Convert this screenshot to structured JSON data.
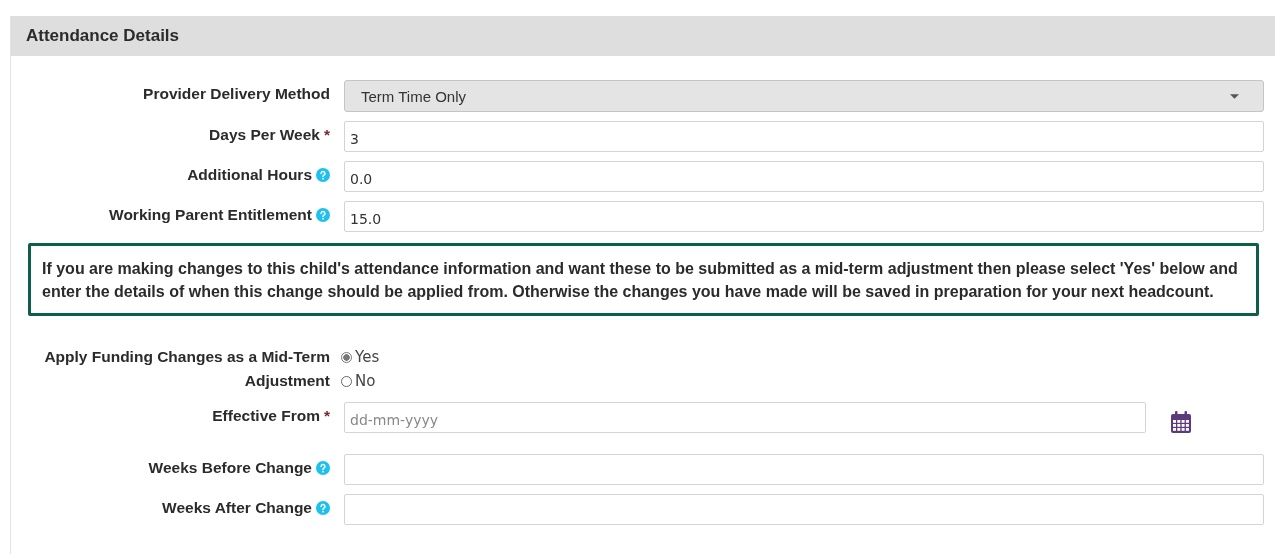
{
  "section": {
    "title": "Attendance Details"
  },
  "fields": [
    {
      "kind": "select",
      "label": "Provider Delivery Method",
      "value": "Term Time Only",
      "help": false
    },
    {
      "kind": "text",
      "label": "Days Per Week",
      "required_mark": "*",
      "value": "3",
      "help": false
    },
    {
      "kind": "text",
      "label": "Additional Hours",
      "value": "0.0",
      "help": true
    },
    {
      "kind": "text",
      "label": "Working Parent Entitlement",
      "value": "15.0",
      "help": true
    }
  ],
  "notice": "If you are making changes to this child's attendance information and want these to be submitted as a mid-term adjustment then please select 'Yes' below and enter the details of when this change should be applied from. Otherwise the changes you have made will be saved in preparation for your next headcount.",
  "adjustment_fields": [
    {
      "kind": "radio",
      "label": "Apply Funding Changes as a Mid-Term Adjustment",
      "help": false,
      "options": [
        {
          "label": "Yes",
          "selected": true
        },
        {
          "label": "No",
          "selected": false
        }
      ]
    },
    {
      "kind": "date",
      "label": "Effective From",
      "required_mark": "*",
      "placeholder": "dd-mm-yyyy",
      "help": false
    },
    {
      "kind": "text",
      "label": "Weeks Before Change",
      "help": true
    },
    {
      "kind": "text",
      "label": "Weeks After Change",
      "help": true
    }
  ]
}
